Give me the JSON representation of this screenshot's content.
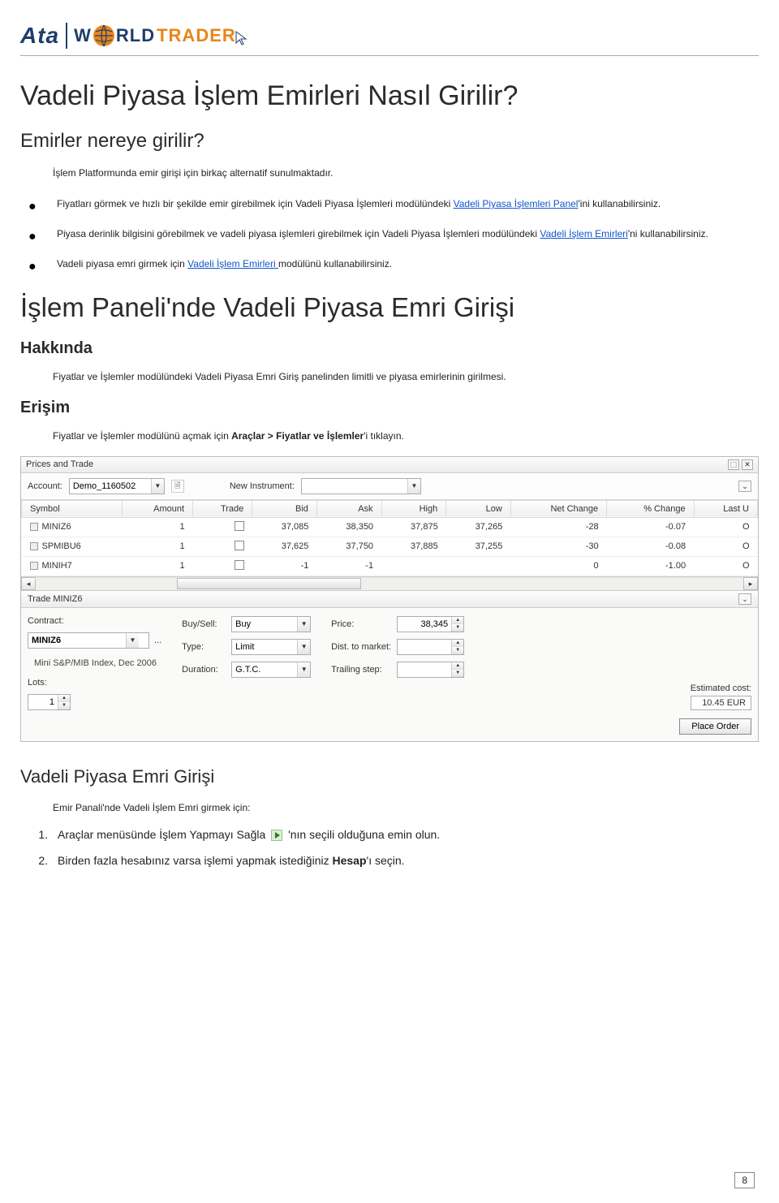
{
  "logo": {
    "ata": "Ata",
    "w": "W",
    "rld": "RLD",
    "trader": "TRADER"
  },
  "title": "Vadeli Piyasa İşlem Emirleri Nasıl Girilir?",
  "subtitle": "Emirler nereye girilir?",
  "intro": "İşlem Platformunda emir girişi için birkaç alternatif sunulmaktadır.",
  "bullets": {
    "b1a": "Fiyatları görmek ve hızlı bir şekilde emir girebilmek için Vadeli Piyasa İşlemleri modülündeki ",
    "b1link": "Vadeli Piyasa İşlemleri Panel",
    "b1b": "'ini kullanabilirsiniz.",
    "b2a": "Piyasa derinlik bilgisini görebilmek ve vadeli piyasa işlemleri girebilmek için Vadeli Piyasa İşlemleri modülündeki ",
    "b2link": "Vadeli İşlem Emirleri",
    "b2b": "'ni kullanabilirsiniz.",
    "b3a": "Vadeli piyasa emri girmek için ",
    "b3link": "Vadeli İşlem Emirleri ",
    "b3b": "modülünü kullanabilirsiniz."
  },
  "section_title": "İşlem Paneli'nde Vadeli Piyasa Emri Girişi",
  "hakkinda": {
    "h": "Hakkında",
    "p": "Fiyatlar ve İşlemler modülündeki Vadeli Piyasa Emri Giriş panelinden limitli ve piyasa emirlerinin girilmesi."
  },
  "erisim": {
    "h": "Erişim",
    "p_a": "Fiyatlar ve İşlemler modülünü açmak için ",
    "p_bold": "Araçlar > Fiyatlar ve İşlemler",
    "p_b": "'i tıklayın."
  },
  "panel": {
    "title": "Prices and Trade",
    "account_lbl": "Account:",
    "account_val": "Demo_1160502",
    "newinstr_lbl": "New Instrument:",
    "newinstr_val": "",
    "cols": [
      "Symbol",
      "Amount",
      "Trade",
      "Bid",
      "Ask",
      "High",
      "Low",
      "Net Change",
      "% Change",
      "Last U"
    ],
    "rows": [
      {
        "sym": "MINIZ6",
        "amt": "1",
        "bid": "37,085",
        "ask": "38,350",
        "high": "37,875",
        "low": "37,265",
        "nc": "-28",
        "pc": "-0.07",
        "last": "O"
      },
      {
        "sym": "SPMIBU6",
        "amt": "1",
        "bid": "37,625",
        "ask": "37,750",
        "high": "37,885",
        "low": "37,255",
        "nc": "-30",
        "pc": "-0.08",
        "last": "O"
      },
      {
        "sym": "MINIH7",
        "amt": "1",
        "bid": "-1",
        "ask": "-1",
        "high": "",
        "low": "",
        "nc": "0",
        "pc": "-1.00",
        "last": "O"
      }
    ],
    "trade_title": "Trade MINIZ6",
    "contract_lbl": "Contract:",
    "contract_val": "MINIZ6",
    "contract_sub": "Mini S&P/MIB Index, Dec 2006",
    "lots_lbl": "Lots:",
    "lots_val": "1",
    "buysell_lbl": "Buy/Sell:",
    "buysell_val": "Buy",
    "type_lbl": "Type:",
    "type_val": "Limit",
    "duration_lbl": "Duration:",
    "duration_val": "G.T.C.",
    "price_lbl": "Price:",
    "price_val": "38,345",
    "dist_lbl": "Dist. to market:",
    "dist_val": "",
    "trail_lbl": "Trailing step:",
    "trail_val": "",
    "est_lbl": "Estimated cost:",
    "est_val": "10.45 EUR",
    "order_btn": "Place Order"
  },
  "girisi": {
    "h": "Vadeli Piyasa Emri Girişi",
    "p": "Emir Panali'nde Vadeli İşlem Emri girmek için:",
    "s1a": "Araçlar menüsünde İşlem Yapmayı Sağla",
    "s1b": "'nın seçili olduğuna emin olun.",
    "s2a": "Birden fazla hesabınız varsa işlemi yapmak istediğiniz ",
    "s2bold": "Hesap",
    "s2b": "'ı seçin."
  },
  "page_number": "8"
}
